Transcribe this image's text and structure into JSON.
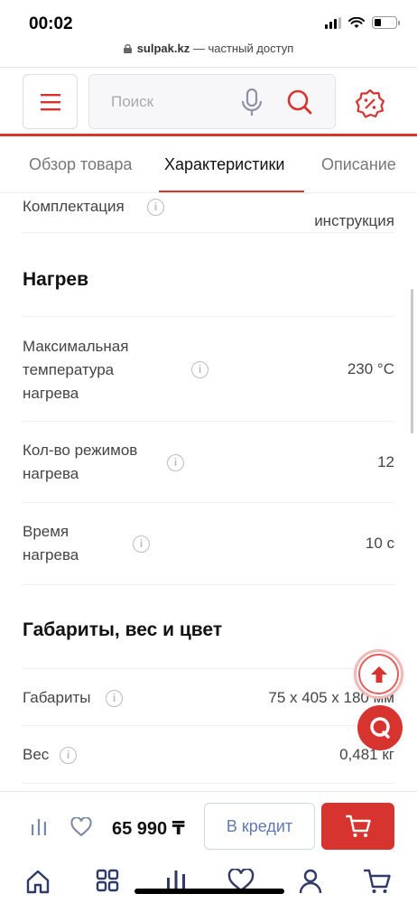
{
  "status": {
    "time": "00:02"
  },
  "browser": {
    "domain": "sulpak.kz",
    "suffix": " — частный доступ"
  },
  "header": {
    "search_placeholder": "Поиск"
  },
  "tabs": [
    {
      "label": "Обзор товара"
    },
    {
      "label": "Характеристики"
    },
    {
      "label": "Описание"
    }
  ],
  "specs": {
    "partial_row": {
      "label": "Комплектация",
      "value": "инструкция"
    },
    "heating": {
      "title": "Нагрев",
      "rows": [
        {
          "label_lines": [
            "Максимальная",
            "температура",
            "нагрева"
          ],
          "value": "230 °C"
        },
        {
          "label_lines": [
            "Кол-во режимов",
            "нагрева"
          ],
          "value": "12"
        },
        {
          "label_lines": [
            "Время",
            "нагрева"
          ],
          "value": "10 с"
        }
      ]
    },
    "dimensions": {
      "title": "Габариты, вес и цвет",
      "rows": [
        {
          "label": "Габариты",
          "value": "75 x 405 x 180 мм"
        },
        {
          "label": "Вес",
          "value": "0,481 кг"
        }
      ]
    }
  },
  "buy_bar": {
    "price": "65 990 ₸",
    "credit_label": "В кредит"
  },
  "icons": {
    "menu": "menu-icon",
    "mic": "mic-icon",
    "search": "search-icon",
    "promo": "discount-badge-icon",
    "compare": "compare-icon",
    "favorite": "heart-icon",
    "cart": "cart-icon",
    "up": "arrow-up-icon",
    "chat": "chat-icon",
    "nav": [
      "home-icon",
      "catalog-icon",
      "compare-icon",
      "heart-icon",
      "profile-icon",
      "cart-icon"
    ]
  },
  "colors": {
    "brand_red": "#d7332f",
    "credit_blue": "#6079b8"
  }
}
